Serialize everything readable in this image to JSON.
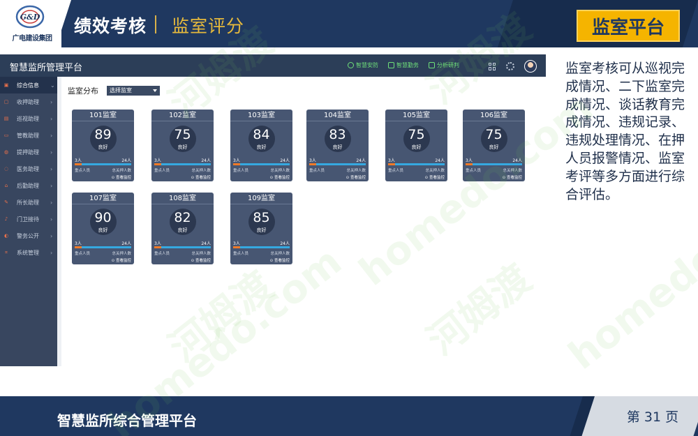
{
  "header": {
    "company_name": "广电建设集团",
    "logo_text": "G&D",
    "title": "绩效考核",
    "subtitle": "监室评分",
    "badge": "监室平台"
  },
  "app": {
    "title": "智慧监所管理平台",
    "nav": [
      {
        "icon": "circle-check-icon",
        "label": "智慧安防"
      },
      {
        "icon": "cube-icon",
        "label": "智慧勤务"
      },
      {
        "icon": "bar-chart-icon",
        "label": "分析研判"
      }
    ],
    "sidebar": [
      {
        "label": "综合信息",
        "active": true
      },
      {
        "label": "收押助理",
        "active": false
      },
      {
        "label": "巡视助理",
        "active": false
      },
      {
        "label": "管教助理",
        "active": false
      },
      {
        "label": "提押助理",
        "active": false
      },
      {
        "label": "医务助理",
        "active": false
      },
      {
        "label": "后勤助理",
        "active": false
      },
      {
        "label": "所长助理",
        "active": false
      },
      {
        "label": "门卫接待",
        "active": false
      },
      {
        "label": "警务公开",
        "active": false
      },
      {
        "label": "系统管理",
        "active": false
      }
    ],
    "filter": {
      "label": "监室分布",
      "select_value": "选择监室"
    },
    "rooms": [
      {
        "name": "101监室",
        "score": "89",
        "grade": "良好",
        "count_left": "3人",
        "count_right": "24人",
        "fill": 0.125,
        "key_left": "重点人员",
        "key_right": "总关押人数",
        "link": "查看监控"
      },
      {
        "name": "102监室",
        "score": "75",
        "grade": "良好",
        "count_left": "3人",
        "count_right": "24人",
        "fill": 0.125,
        "key_left": "重点人员",
        "key_right": "总关押人数",
        "link": "查看监控"
      },
      {
        "name": "103监室",
        "score": "84",
        "grade": "良好",
        "count_left": "3人",
        "count_right": "24人",
        "fill": 0.125,
        "key_left": "重点人员",
        "key_right": "总关押人数",
        "link": "查看监控"
      },
      {
        "name": "104监室",
        "score": "83",
        "grade": "良好",
        "count_left": "3人",
        "count_right": "24人",
        "fill": 0.125,
        "key_left": "重点人员",
        "key_right": "总关押人数",
        "link": "查看监控"
      },
      {
        "name": "105监室",
        "score": "75",
        "grade": "良好",
        "count_left": "3人",
        "count_right": "24人",
        "fill": 0.125,
        "key_left": "重点人员",
        "key_right": "总关押人数",
        "link": "查看监控"
      },
      {
        "name": "106监室",
        "score": "75",
        "grade": "良好",
        "count_left": "3人",
        "count_right": "24人",
        "fill": 0.125,
        "key_left": "重点人员",
        "key_right": "总关押人数",
        "link": "查看监控"
      },
      {
        "name": "107监室",
        "score": "90",
        "grade": "良好",
        "count_left": "3人",
        "count_right": "24人",
        "fill": 0.125,
        "key_left": "重点人员",
        "key_right": "总关押人数",
        "link": "查看监控"
      },
      {
        "name": "108监室",
        "score": "82",
        "grade": "良好",
        "count_left": "3人",
        "count_right": "24人",
        "fill": 0.125,
        "key_left": "重点人员",
        "key_right": "总关押人数",
        "link": "查看监控"
      },
      {
        "name": "109监室",
        "score": "85",
        "grade": "良好",
        "count_left": "3人",
        "count_right": "24人",
        "fill": 0.125,
        "key_left": "重点人员",
        "key_right": "总关押人数",
        "link": "查看监控"
      }
    ]
  },
  "description": "监室考核可从巡视完成情况、二下监室完成情况、谈话教育完成情况、违规记录、违规处理情况、在押人员报警情况、监室考评等多方面进行综合评估。",
  "footer": {
    "title": "智慧监所综合管理平台",
    "page": "第 31 页"
  },
  "watermark": {
    "text_cn": "河姆渡",
    "text_en": "homedo.com"
  },
  "colors": {
    "navy": "#1f3860",
    "gold": "#f5b400",
    "card": "#475672",
    "bar_orange": "#f07a28",
    "bar_blue": "#35a8e0"
  }
}
